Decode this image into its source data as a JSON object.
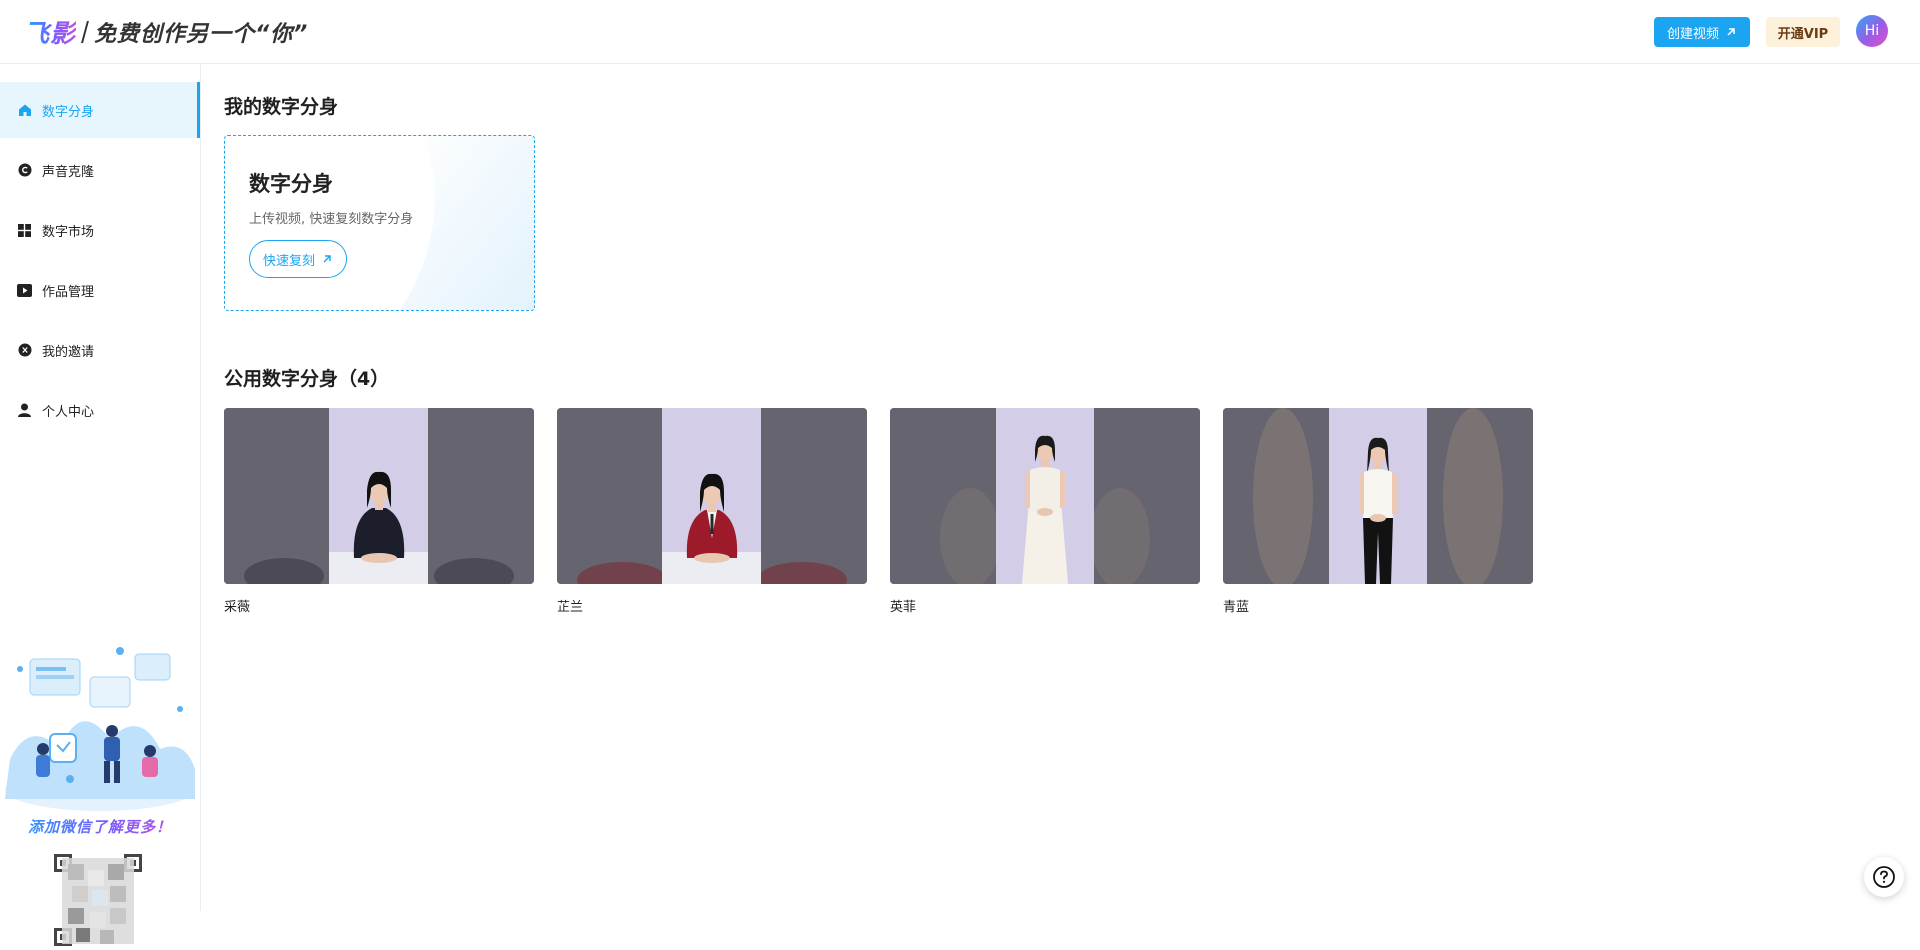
{
  "header": {
    "logo_mark": "飞影",
    "slogan": "免费创作另一个“你”",
    "create_video_label": "创建视频",
    "vip_label": "开通VIP",
    "avatar_text": "Hi"
  },
  "sidebar": {
    "items": [
      {
        "label": "数字分身",
        "icon": "home-icon",
        "active": true
      },
      {
        "label": "声音克隆",
        "icon": "copyright-c-icon",
        "active": false
      },
      {
        "label": "数字市场",
        "icon": "grid-icon",
        "active": false
      },
      {
        "label": "作品管理",
        "icon": "video-play-icon",
        "active": false
      },
      {
        "label": "我的邀请",
        "icon": "invite-icon",
        "active": false
      },
      {
        "label": "个人中心",
        "icon": "user-icon",
        "active": false
      }
    ],
    "promo_text": "添加微信了解更多！"
  },
  "main": {
    "my_section_title": "我的数字分身",
    "my_card": {
      "title": "数字分身",
      "description": "上传视频, 快速复刻数字分身",
      "button_label": "快速复刻"
    },
    "public_section_title": "公用数字分身（4）",
    "public_avatars": [
      {
        "name": "采薇",
        "outfit": "dark-sweater-seated"
      },
      {
        "name": "芷兰",
        "outfit": "red-blazer-seated"
      },
      {
        "name": "英菲",
        "outfit": "white-dress-standing"
      },
      {
        "name": "青蓝",
        "outfit": "white-top-black-pants-standing"
      }
    ]
  },
  "colors": {
    "accent": "#1ba5f0",
    "active_bg": "#e7f5fd",
    "vip_bg": "#fdf1dc",
    "vip_text": "#6b3b12",
    "thumb_side": "#66646f",
    "thumb_center": "#d3cde8"
  }
}
